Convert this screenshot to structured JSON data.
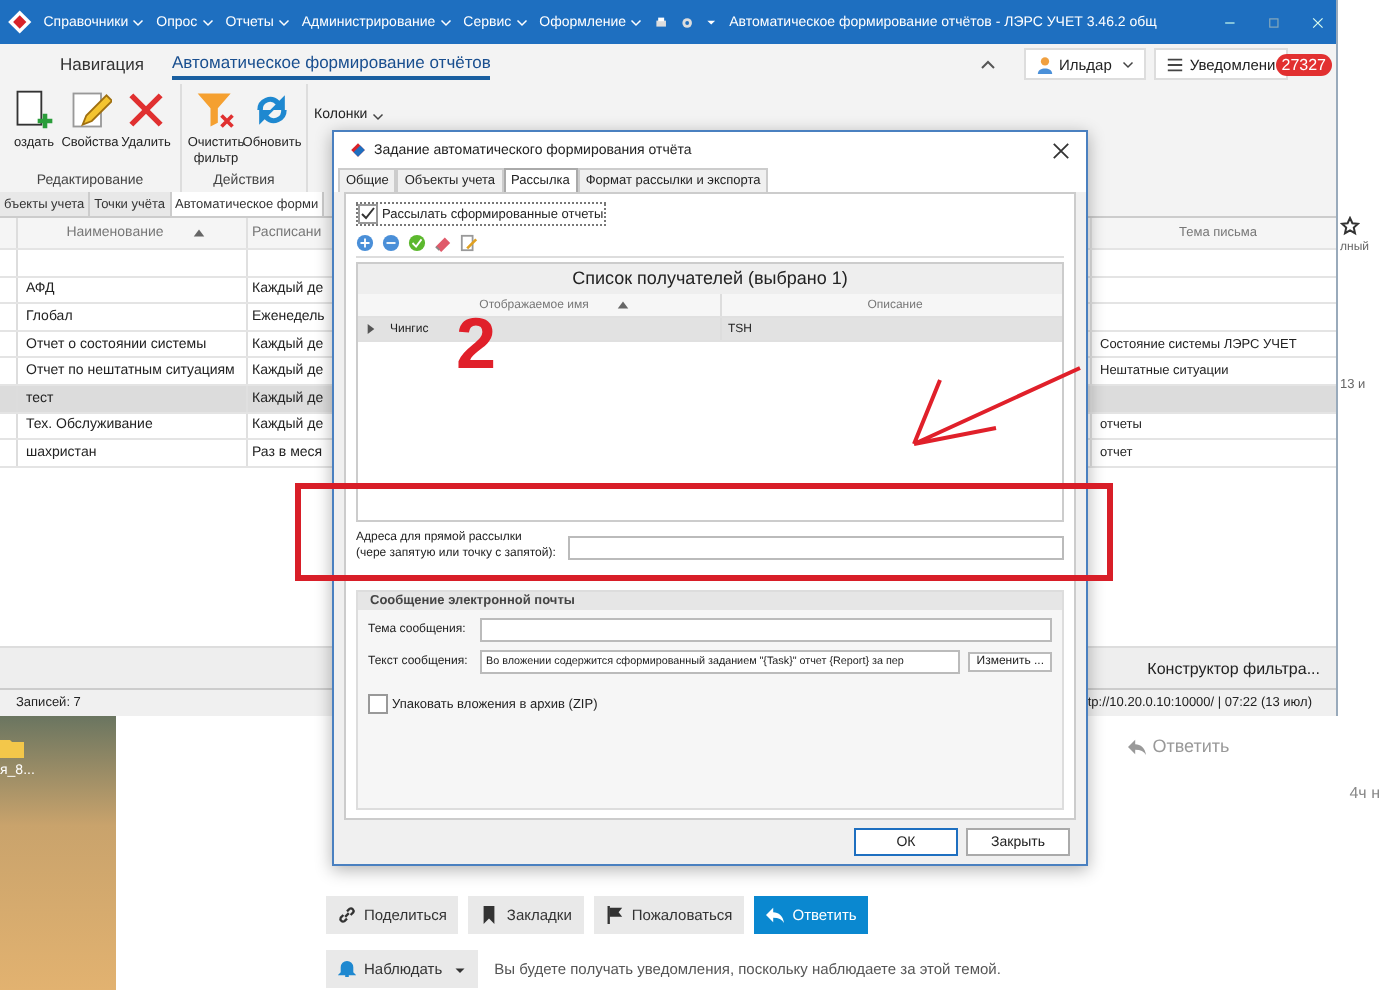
{
  "app": {
    "menu": [
      "Справочники",
      "Опрос",
      "Отчеты",
      "Администрирование",
      "Сервис",
      "Оформление"
    ],
    "title": "Автоматическое формирование отчётов - ЛЭРС УЧЕТ 3.46.2 общ",
    "ribbon_tabs": [
      {
        "label": "Навигация",
        "selected": false
      },
      {
        "label": "Автоматическое формирование отчётов",
        "selected": true
      }
    ],
    "user": "Ильдар",
    "notifications": {
      "label": "Уведомлени",
      "count": "27327"
    },
    "groups": [
      {
        "label": "Редактирование",
        "buttons": [
          {
            "label": "оздать"
          },
          {
            "label": "Свойства"
          },
          {
            "label": "Удалить"
          }
        ]
      },
      {
        "label": "Действия",
        "buttons": [
          {
            "label": "Очистить фильтр"
          },
          {
            "label": "Обновить"
          }
        ]
      }
    ],
    "columns_menu": "Колонки",
    "doc_tabs": [
      {
        "label": "бъекты учета",
        "selected": false
      },
      {
        "label": "Точки учёта",
        "selected": false
      },
      {
        "label": "Автоматическое форми",
        "selected": true
      }
    ],
    "table": {
      "columns": [
        "Наименование",
        "Расписани",
        "Тема письма"
      ],
      "rows": [
        {
          "name": "АФД",
          "schedule": "Каждый де",
          "subject": "",
          "selected": false
        },
        {
          "name": "Глобал",
          "schedule": "Еженедель",
          "subject": "",
          "selected": false
        },
        {
          "name": "Отчет о состоянии системы",
          "schedule": "Каждый де",
          "subject": "Состояние системы ЛЭРС УЧЕТ",
          "selected": false
        },
        {
          "name": "Отчет по нештатным ситуациям",
          "schedule": "Каждый де",
          "subject": "Нештатные ситуации",
          "selected": false
        },
        {
          "name": "тест",
          "schedule": "Каждый де",
          "subject": "",
          "selected": true
        },
        {
          "name": "Тех. Обслуживание",
          "schedule": "Каждый де",
          "subject": "отчеты",
          "selected": false
        },
        {
          "name": "шахристан",
          "schedule": "Раз в меся",
          "subject": "отчет",
          "selected": false
        }
      ]
    },
    "filter_builder": "Конструктор фильтра...",
    "status": {
      "records": "Записей: 7",
      "connection": "tp://10.20.0.10:10000/ | 07:22 (13 июл)"
    }
  },
  "dialog": {
    "title": "Задание автоматического формирования отчёта",
    "tabs": [
      {
        "label": "Общие",
        "selected": false
      },
      {
        "label": "Объекты учета",
        "selected": false
      },
      {
        "label": "Рассылка",
        "selected": true
      },
      {
        "label": "Формат рассылки и экспорта",
        "selected": false
      }
    ],
    "send_reports": {
      "label": "Рассылать сформированные отчеты",
      "checked": true
    },
    "recipients": {
      "caption": "Список получателей (выбрано 1)",
      "columns": [
        "Отображаемое имя",
        "Описание"
      ],
      "rows": [
        {
          "name": "Чингис",
          "description": "TSH",
          "selected": true
        }
      ]
    },
    "direct_addresses": {
      "label": "Адреса для прямой рассылки\n(чере запятую или точку с запятой):"
    },
    "email_group": "Сообщение электронной почты",
    "subject_label": "Тема сообщения:",
    "body_label": "Текст сообщения:",
    "body_value": "Во вложении содержится сформированный заданием \"{Task}\" отчет {Report} за пер",
    "change_button": "Изменить ...",
    "zip": {
      "label": "Упаковать вложения в архив (ZIP)",
      "checked": false
    },
    "buttons": [
      {
        "label": "ОК",
        "default": true
      },
      {
        "label": "Закрыть",
        "default": false
      }
    ]
  },
  "annotation": {
    "number": "2"
  },
  "side": {
    "fragment": "лный",
    "date": "13 и"
  },
  "forum": {
    "desktop_label": "я_8...",
    "reply_link": "Ответить",
    "time": "4ч н",
    "actions": [
      {
        "label": "Поделиться",
        "primary": false
      },
      {
        "label": "Закладки",
        "primary": false
      },
      {
        "label": "Пожаловаться",
        "primary": false
      },
      {
        "label": "Ответить",
        "primary": true
      }
    ],
    "watch": {
      "label": "Наблюдать",
      "note": "Вы будете получать уведомления, поскольку наблюдаете за этой темой."
    }
  }
}
